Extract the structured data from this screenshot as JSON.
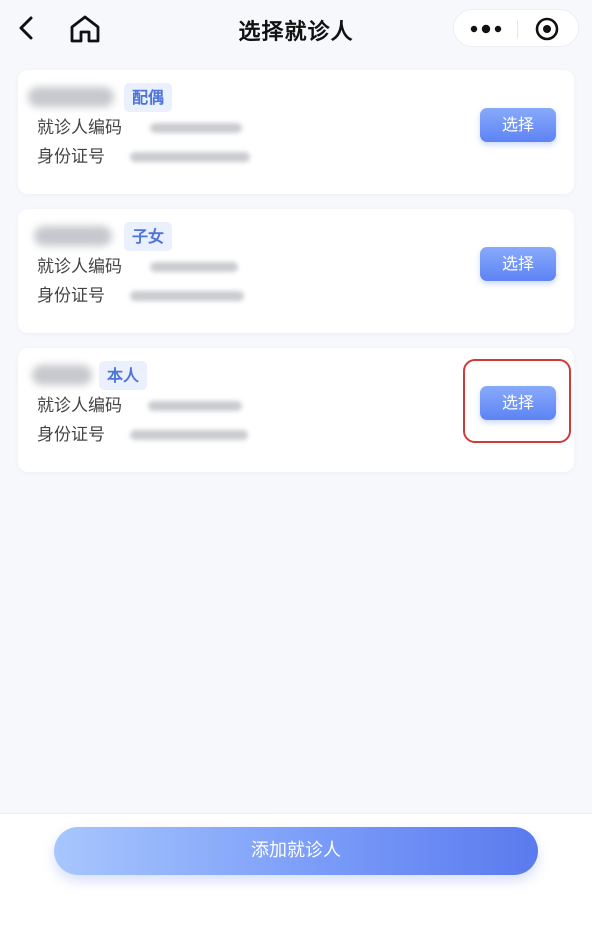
{
  "header": {
    "title": "选择就诊人"
  },
  "labels": {
    "patient_code": "就诊人编码",
    "id_number": "身份证号"
  },
  "patients": [
    {
      "relation": "配偶",
      "select_label": "选择"
    },
    {
      "relation": "子女",
      "select_label": "选择"
    },
    {
      "relation": "本人",
      "select_label": "选择"
    }
  ],
  "footer": {
    "add_label": "添加就诊人"
  },
  "colors": {
    "accent": "#5d83f4",
    "tag_background": "#eaf0fd",
    "tag_text": "#4d74d8",
    "highlight": "#d03a3a"
  }
}
